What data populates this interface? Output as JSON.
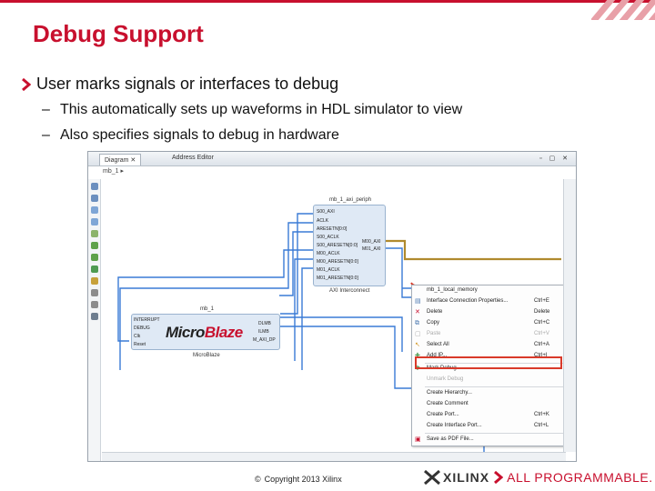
{
  "slide": {
    "title": "Debug Support",
    "bullet": "User marks signals or interfaces to debug",
    "sub_bullets": [
      "This automatically sets up waveforms in HDL simulator to view",
      "Also specifies signals to debug in hardware"
    ],
    "dash": "–"
  },
  "screenshot": {
    "tab_diagram": "Diagram",
    "tab_address": "Address Editor",
    "design_name": "mb_1",
    "axi_block": {
      "name": "mb_1_axi_periph",
      "sublabel": "AXI Interconnect",
      "pins_left": [
        "S00_AXI",
        "ACLK",
        "ARESETN[0:0]",
        "S00_ACLK",
        "S00_ARESETN[0:0]",
        "M00_ACLK",
        "M00_ARESETN[0:0]",
        "M01_ACLK",
        "M01_ARESETN[0:0]"
      ],
      "pins_right": [
        "M00_AXI",
        "M01_AXI"
      ]
    },
    "mb_block": {
      "name": "mb_1",
      "sublabel": "MicroBlaze",
      "logo_main": "Micro",
      "logo_accent": "Blaze",
      "pins_left": [
        "INTERRUPT",
        "DEBUG",
        "Clk",
        "Reset"
      ],
      "pins_right": [
        "DLMB",
        "ILMB",
        "M_AXI_DP"
      ]
    },
    "context_menu": {
      "header": "mb_1_local_memory",
      "items": [
        {
          "label": "Interface Connection Properties...",
          "shortcut": "Ctrl+E",
          "enabled": true
        },
        {
          "label": "Delete",
          "shortcut": "Delete",
          "enabled": true
        },
        {
          "label": "Copy",
          "shortcut": "Ctrl+C",
          "enabled": true
        },
        {
          "label": "Paste",
          "shortcut": "Ctrl+V",
          "enabled": false
        },
        {
          "label": "Select All",
          "shortcut": "Ctrl+A",
          "enabled": true
        },
        {
          "label": "Add IP...",
          "shortcut": "Ctrl+I",
          "enabled": true
        },
        {
          "label": "Mark Debug",
          "shortcut": "",
          "enabled": true
        },
        {
          "label": "Unmark Debug",
          "shortcut": "",
          "enabled": false
        },
        {
          "label": "Create Hierarchy...",
          "shortcut": "",
          "enabled": true
        },
        {
          "label": "Create Comment",
          "shortcut": "",
          "enabled": true
        },
        {
          "label": "Create Port...",
          "shortcut": "Ctrl+K",
          "enabled": true
        },
        {
          "label": "Create Interface Port...",
          "shortcut": "Ctrl+L",
          "enabled": true
        },
        {
          "label": "Save as PDF File...",
          "shortcut": "",
          "enabled": true
        }
      ]
    }
  },
  "footer": {
    "copyright_symbol": "©",
    "copyright": "Copyright 2013 Xilinx",
    "brand": "XILINX",
    "tagline": "ALL PROGRAMMABLE."
  },
  "colors": {
    "accent": "#c8102e",
    "wire": "#3a7bd5",
    "debug_wire": "#b08a2e",
    "highlight": "#d93a2a"
  }
}
